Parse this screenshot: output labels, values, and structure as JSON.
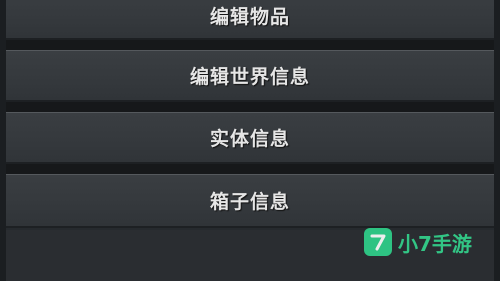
{
  "menu": {
    "items": [
      {
        "label": "编辑物品"
      },
      {
        "label": "编辑世界信息"
      },
      {
        "label": "实体信息"
      },
      {
        "label": "箱子信息"
      }
    ]
  },
  "watermark": {
    "logo_glyph": "7",
    "text": "小7手游",
    "color": "#33d48d"
  }
}
